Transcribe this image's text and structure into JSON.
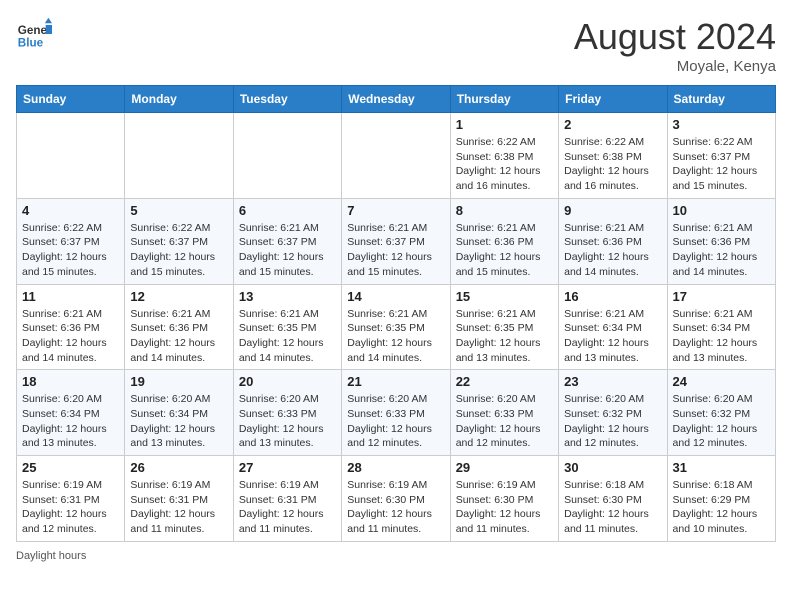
{
  "header": {
    "logo_line1": "General",
    "logo_line2": "Blue",
    "month_year": "August 2024",
    "location": "Moyale, Kenya"
  },
  "days_of_week": [
    "Sunday",
    "Monday",
    "Tuesday",
    "Wednesday",
    "Thursday",
    "Friday",
    "Saturday"
  ],
  "footer": {
    "label": "Daylight hours"
  },
  "weeks": [
    {
      "cells": [
        {
          "day": "",
          "info": ""
        },
        {
          "day": "",
          "info": ""
        },
        {
          "day": "",
          "info": ""
        },
        {
          "day": "",
          "info": ""
        },
        {
          "day": "1",
          "info": "Sunrise: 6:22 AM\nSunset: 6:38 PM\nDaylight: 12 hours and 16 minutes."
        },
        {
          "day": "2",
          "info": "Sunrise: 6:22 AM\nSunset: 6:38 PM\nDaylight: 12 hours and 16 minutes."
        },
        {
          "day": "3",
          "info": "Sunrise: 6:22 AM\nSunset: 6:37 PM\nDaylight: 12 hours and 15 minutes."
        }
      ]
    },
    {
      "cells": [
        {
          "day": "4",
          "info": "Sunrise: 6:22 AM\nSunset: 6:37 PM\nDaylight: 12 hours and 15 minutes."
        },
        {
          "day": "5",
          "info": "Sunrise: 6:22 AM\nSunset: 6:37 PM\nDaylight: 12 hours and 15 minutes."
        },
        {
          "day": "6",
          "info": "Sunrise: 6:21 AM\nSunset: 6:37 PM\nDaylight: 12 hours and 15 minutes."
        },
        {
          "day": "7",
          "info": "Sunrise: 6:21 AM\nSunset: 6:37 PM\nDaylight: 12 hours and 15 minutes."
        },
        {
          "day": "8",
          "info": "Sunrise: 6:21 AM\nSunset: 6:36 PM\nDaylight: 12 hours and 15 minutes."
        },
        {
          "day": "9",
          "info": "Sunrise: 6:21 AM\nSunset: 6:36 PM\nDaylight: 12 hours and 14 minutes."
        },
        {
          "day": "10",
          "info": "Sunrise: 6:21 AM\nSunset: 6:36 PM\nDaylight: 12 hours and 14 minutes."
        }
      ]
    },
    {
      "cells": [
        {
          "day": "11",
          "info": "Sunrise: 6:21 AM\nSunset: 6:36 PM\nDaylight: 12 hours and 14 minutes."
        },
        {
          "day": "12",
          "info": "Sunrise: 6:21 AM\nSunset: 6:36 PM\nDaylight: 12 hours and 14 minutes."
        },
        {
          "day": "13",
          "info": "Sunrise: 6:21 AM\nSunset: 6:35 PM\nDaylight: 12 hours and 14 minutes."
        },
        {
          "day": "14",
          "info": "Sunrise: 6:21 AM\nSunset: 6:35 PM\nDaylight: 12 hours and 14 minutes."
        },
        {
          "day": "15",
          "info": "Sunrise: 6:21 AM\nSunset: 6:35 PM\nDaylight: 12 hours and 13 minutes."
        },
        {
          "day": "16",
          "info": "Sunrise: 6:21 AM\nSunset: 6:34 PM\nDaylight: 12 hours and 13 minutes."
        },
        {
          "day": "17",
          "info": "Sunrise: 6:21 AM\nSunset: 6:34 PM\nDaylight: 12 hours and 13 minutes."
        }
      ]
    },
    {
      "cells": [
        {
          "day": "18",
          "info": "Sunrise: 6:20 AM\nSunset: 6:34 PM\nDaylight: 12 hours and 13 minutes."
        },
        {
          "day": "19",
          "info": "Sunrise: 6:20 AM\nSunset: 6:34 PM\nDaylight: 12 hours and 13 minutes."
        },
        {
          "day": "20",
          "info": "Sunrise: 6:20 AM\nSunset: 6:33 PM\nDaylight: 12 hours and 13 minutes."
        },
        {
          "day": "21",
          "info": "Sunrise: 6:20 AM\nSunset: 6:33 PM\nDaylight: 12 hours and 12 minutes."
        },
        {
          "day": "22",
          "info": "Sunrise: 6:20 AM\nSunset: 6:33 PM\nDaylight: 12 hours and 12 minutes."
        },
        {
          "day": "23",
          "info": "Sunrise: 6:20 AM\nSunset: 6:32 PM\nDaylight: 12 hours and 12 minutes."
        },
        {
          "day": "24",
          "info": "Sunrise: 6:20 AM\nSunset: 6:32 PM\nDaylight: 12 hours and 12 minutes."
        }
      ]
    },
    {
      "cells": [
        {
          "day": "25",
          "info": "Sunrise: 6:19 AM\nSunset: 6:31 PM\nDaylight: 12 hours and 12 minutes."
        },
        {
          "day": "26",
          "info": "Sunrise: 6:19 AM\nSunset: 6:31 PM\nDaylight: 12 hours and 11 minutes."
        },
        {
          "day": "27",
          "info": "Sunrise: 6:19 AM\nSunset: 6:31 PM\nDaylight: 12 hours and 11 minutes."
        },
        {
          "day": "28",
          "info": "Sunrise: 6:19 AM\nSunset: 6:30 PM\nDaylight: 12 hours and 11 minutes."
        },
        {
          "day": "29",
          "info": "Sunrise: 6:19 AM\nSunset: 6:30 PM\nDaylight: 12 hours and 11 minutes."
        },
        {
          "day": "30",
          "info": "Sunrise: 6:18 AM\nSunset: 6:30 PM\nDaylight: 12 hours and 11 minutes."
        },
        {
          "day": "31",
          "info": "Sunrise: 6:18 AM\nSunset: 6:29 PM\nDaylight: 12 hours and 10 minutes."
        }
      ]
    }
  ]
}
